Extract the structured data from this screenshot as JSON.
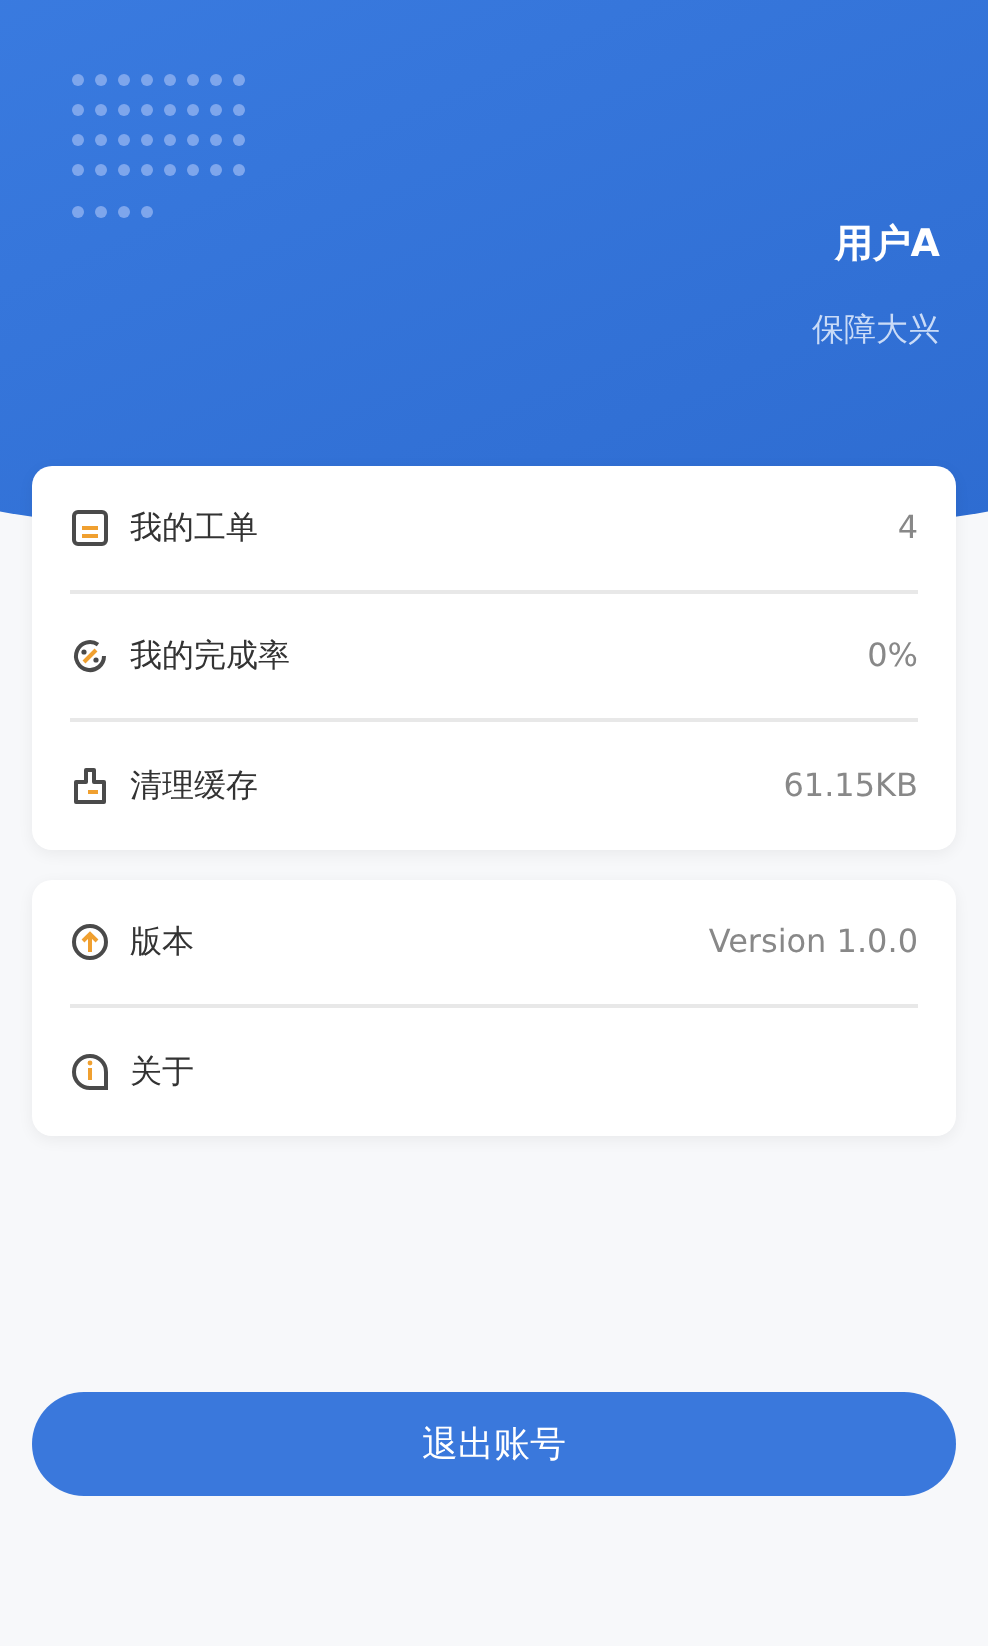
{
  "profile": {
    "name": "用户A",
    "org": "保障大兴"
  },
  "groups": [
    {
      "items": [
        {
          "label": "我的工单",
          "value": "4"
        },
        {
          "label": "我的完成率",
          "value": "0%"
        },
        {
          "label": "清理缓存",
          "value": "61.15KB"
        }
      ]
    },
    {
      "items": [
        {
          "label": "版本",
          "value": "Version 1.0.0"
        },
        {
          "label": "关于"
        }
      ]
    }
  ],
  "logout_button": "退出账号"
}
